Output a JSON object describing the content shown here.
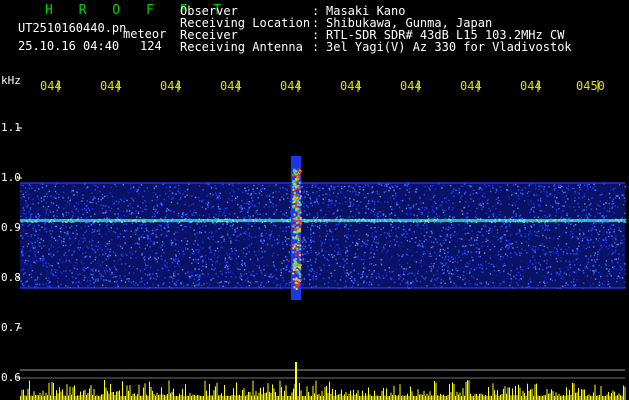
{
  "header": {
    "app_title": "H R O F F T",
    "file_name": "UT2510160440.pn",
    "mode": "meteor",
    "datetime": "25.10.16 04:40",
    "count": "124",
    "info_rows": [
      {
        "label": "Observer",
        "value": "Masaki Kano"
      },
      {
        "label": "Receiving Location",
        "value": "Shibukawa, Gunma, Japan"
      },
      {
        "label": "Receiver",
        "value": "RTL-SDR SDR# 43dB L15 103.2MHz CW"
      },
      {
        "label": "Receiving Antenna",
        "value": "3el Yagi(V) Az 330 for Vladivostok"
      }
    ]
  },
  "colors": {
    "title": "#00d400",
    "time_ticks": "#e0e000",
    "spectrum_band": "#1e3cff",
    "carrier_line": "#29d6c4",
    "meteor_core": "#ff2a2a",
    "power_bars": "#ffff00"
  },
  "chart_data": {
    "type": "heatmap",
    "ylabel": "kHz",
    "x_ticks": [
      "044",
      "044",
      "044",
      "044",
      "044",
      "044",
      "044",
      "044",
      "044",
      "0450"
    ],
    "y_ticks": [
      "1.1",
      "1.0",
      "0.9",
      "0.8",
      "0.7",
      "0.6"
    ],
    "ylim": [
      0.6,
      1.1
    ],
    "band_range_khz": [
      0.78,
      0.99
    ],
    "carrier_khz": 0.915,
    "meteor_event": {
      "x_tick_index": 4,
      "freq_range_khz": [
        0.78,
        1.02
      ]
    }
  }
}
